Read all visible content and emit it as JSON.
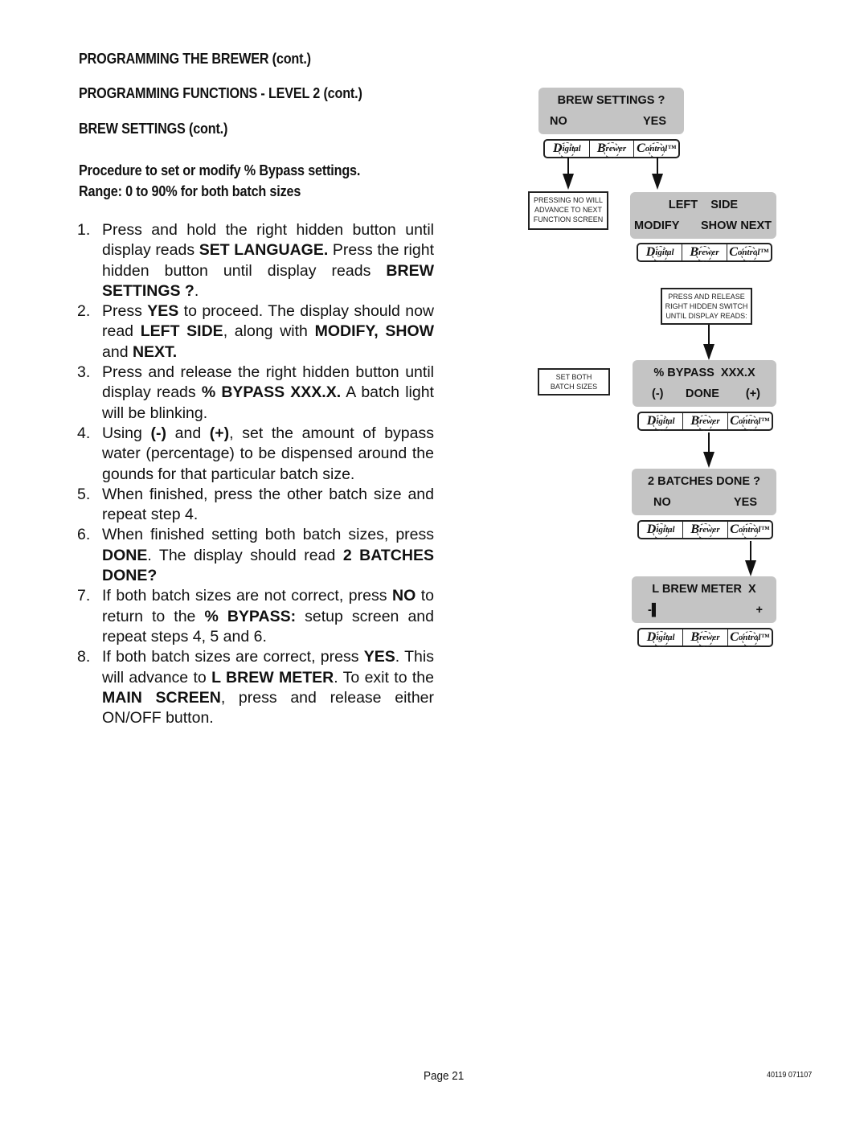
{
  "headings": {
    "h1": "PROGRAMMING THE BREWER (cont.)",
    "h2": "PROGRAMMING FUNCTIONS - LEVEL  2 (cont.)",
    "h3": "BREW SETTINGS (cont.)",
    "procedure_line1": "Procedure to set or modify % Bypass settings.",
    "procedure_line2": "Range: 0 to 90% for both batch sizes"
  },
  "steps": [
    {
      "num": "1.",
      "parts": [
        {
          "t": "Press and hold the right hidden button until display reads ",
          "b": false
        },
        {
          "t": "SET LANGUAGE.",
          "b": true
        },
        {
          "t": " Press the right hidden button until display reads ",
          "b": false
        },
        {
          "t": "BREW SETTINGS ?",
          "b": true
        },
        {
          "t": ".",
          "b": false
        }
      ]
    },
    {
      "num": "2.",
      "parts": [
        {
          "t": "Press ",
          "b": false
        },
        {
          "t": "YES",
          "b": true
        },
        {
          "t": " to proceed. The display should now read ",
          "b": false
        },
        {
          "t": "LEFT  SIDE",
          "b": true
        },
        {
          "t": ", along with ",
          "b": false
        },
        {
          "t": "MODIFY, SHOW",
          "b": true
        },
        {
          "t": " and ",
          "b": false
        },
        {
          "t": "NEXT.",
          "b": true
        }
      ]
    },
    {
      "num": "3.",
      "parts": [
        {
          "t": "Press and release the right hidden button until display reads ",
          "b": false
        },
        {
          "t": "% BYPASS XXX.X.",
          "b": true
        },
        {
          "t": " A batch light will be blinking.",
          "b": false
        }
      ]
    },
    {
      "num": "4.",
      "parts": [
        {
          "t": "Using ",
          "b": false
        },
        {
          "t": "(-)",
          "b": true
        },
        {
          "t": " and ",
          "b": false
        },
        {
          "t": "(+)",
          "b": true
        },
        {
          "t": ", set the amount of bypass water (percentage) to be dispensed around the gounds for that particular batch size.",
          "b": false
        }
      ]
    },
    {
      "num": "5.",
      "parts": [
        {
          "t": "When finished, press the other batch size and repeat step 4.",
          "b": false
        }
      ]
    },
    {
      "num": "6.",
      "parts": [
        {
          "t": "When finished setting both batch sizes, press ",
          "b": false
        },
        {
          "t": "DONE",
          "b": true
        },
        {
          "t": ". The display should read ",
          "b": false
        },
        {
          "t": "2 BATCHES DONE?",
          "b": true
        }
      ]
    },
    {
      "num": "7.",
      "parts": [
        {
          "t": "If both batch sizes are not correct, press ",
          "b": false
        },
        {
          "t": "NO",
          "b": true
        },
        {
          "t": " to return to the ",
          "b": false
        },
        {
          "t": "% BYPASS:",
          "b": true
        },
        {
          "t": " setup screen and repeat steps 4, 5 and 6.",
          "b": false
        }
      ]
    },
    {
      "num": "8.",
      "parts": [
        {
          "t": "If both batch sizes are correct, press ",
          "b": false
        },
        {
          "t": "YES",
          "b": true
        },
        {
          "t": ". This will advance to ",
          "b": false
        },
        {
          "t": "L BREW METER",
          "b": true
        },
        {
          "t": ". To exit to the ",
          "b": false
        },
        {
          "t": "MAIN SCREEN",
          "b": true
        },
        {
          "t": ", press and release either ON/OFF button.",
          "b": false
        }
      ]
    }
  ],
  "diagram": {
    "button_strip": {
      "digital": "igital",
      "digital_cap": "D",
      "brewer": "rewer",
      "brewer_cap": "B",
      "control": "ontrol™",
      "control_cap": "C"
    },
    "screens": [
      {
        "line1": "BREW SETTINGS ?",
        "left": "NO",
        "center": "",
        "right": "YES"
      },
      {
        "line1": "LEFT    SIDE",
        "left": "MODIFY",
        "center": "SHOW",
        "right": "NEXT"
      },
      {
        "line1": "% BYPASS  XXX.X",
        "left": "(-)",
        "center": "DONE",
        "right": "(+)"
      },
      {
        "line1": "2 BATCHES DONE ?",
        "left": "NO",
        "center": "",
        "right": "YES"
      },
      {
        "line1": "L BREW METER  X",
        "left": "-▌",
        "center": "",
        "right": "+"
      }
    ],
    "notes": {
      "pressing_no": [
        "PRESSING NO WILL",
        "ADVANCE TO NEXT",
        "FUNCTION SCREEN"
      ],
      "press_release": [
        "PRESS AND RELEASE",
        "RIGHT HIDDEN SWITCH",
        "UNTIL DISPLAY READS:"
      ],
      "set_both": [
        "SET BOTH",
        "BATCH SIZES"
      ]
    }
  },
  "footer": {
    "page": "Page 21",
    "code": "40119 071107"
  }
}
